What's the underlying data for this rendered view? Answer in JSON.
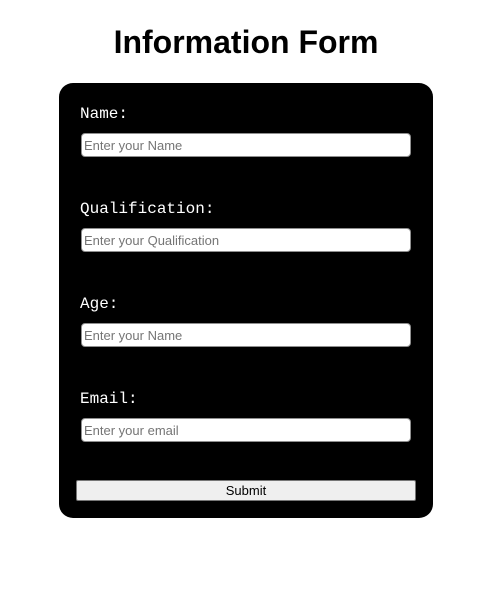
{
  "page": {
    "title": "Information Form"
  },
  "form": {
    "fields": [
      {
        "label": "Name:",
        "value": "",
        "placeholder": "Enter your Name"
      },
      {
        "label": "Qualification:",
        "value": "",
        "placeholder": "Enter your Qualification"
      },
      {
        "label": "Age:",
        "value": "",
        "placeholder": "Enter your Name"
      },
      {
        "label": "Email:",
        "value": "",
        "placeholder": "Enter your email"
      }
    ],
    "submit_label": "Submit"
  },
  "colors": {
    "page_background": "#ffffff",
    "card_background": "#000000",
    "label_text": "#ffffff",
    "input_background": "#ffffff",
    "button_background": "#efefef"
  }
}
